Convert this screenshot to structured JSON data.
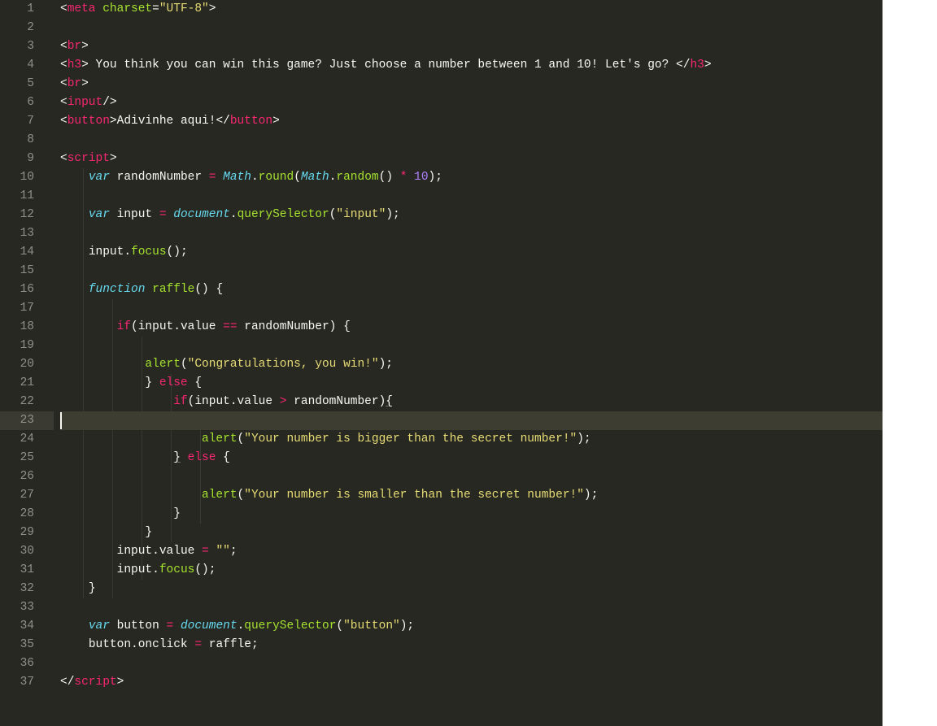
{
  "editor": {
    "lineCount": 37,
    "activeLine": 23
  },
  "source": {
    "language": "html-with-js",
    "plain": "<meta charset=\"UTF-8\">\n\n<br>\n<h3> You think you can win this game? Just choose a number between 1 and 10! Let's go? </h3>\n<br>\n<input/>\n<button>Adivinhe aqui!</button>\n\n<script>\n    var randomNumber = Math.round(Math.random() * 10);\n\n    var input = document.querySelector(\"input\");\n\n    input.focus();\n\n    function raffle() {\n\n        if(input.value == randomNumber) {\n\n            alert(\"Congratulations, you win!\");\n            } else {\n                if(input.value > randomNumber){\n\n                    alert(\"Your number is bigger than the secret number!\");\n                } else {\n\n                    alert(\"Your number is smaller than the secret number!\");\n                }\n            }\n        input.value = \"\";\n        input.focus();\n    }\n\n    var button = document.querySelector(\"button\");\n    button.onclick = raffle;\n\n</script>"
  },
  "tokens": {
    "meta": "meta",
    "charset": "charset",
    "utf8": "\"UTF-8\"",
    "br": "br",
    "h3": "h3",
    "h3text": " You think you can win this game? Just choose a number between 1 and 10! Let's go? ",
    "input": "input",
    "button": "button",
    "btnText": "Adivinhe aqui!",
    "script": "script",
    "var": "var",
    "randomNumber": "randomNumber",
    "eq": "=",
    "Math": "Math",
    "round": "round",
    "random": "random",
    "star": "*",
    "ten": "10",
    "inputVar": "input",
    "document": "document",
    "querySelector": "querySelector",
    "strInput": "\"input\"",
    "focus": "focus",
    "function": "function",
    "raffle": "raffle",
    "if": "if",
    "value": "value",
    "deq": "==",
    "alert": "alert",
    "winStr": "\"Congratulations, you win!\"",
    "else": "else",
    "gt": ">",
    "biggerStr": "\"Your number is bigger than the secret number!\"",
    "smallerStr": "\"Your number is smaller than the secret number!\"",
    "empty": "\"\"",
    "buttonVar": "button",
    "strButton": "\"button\"",
    "onclick": "onclick"
  }
}
